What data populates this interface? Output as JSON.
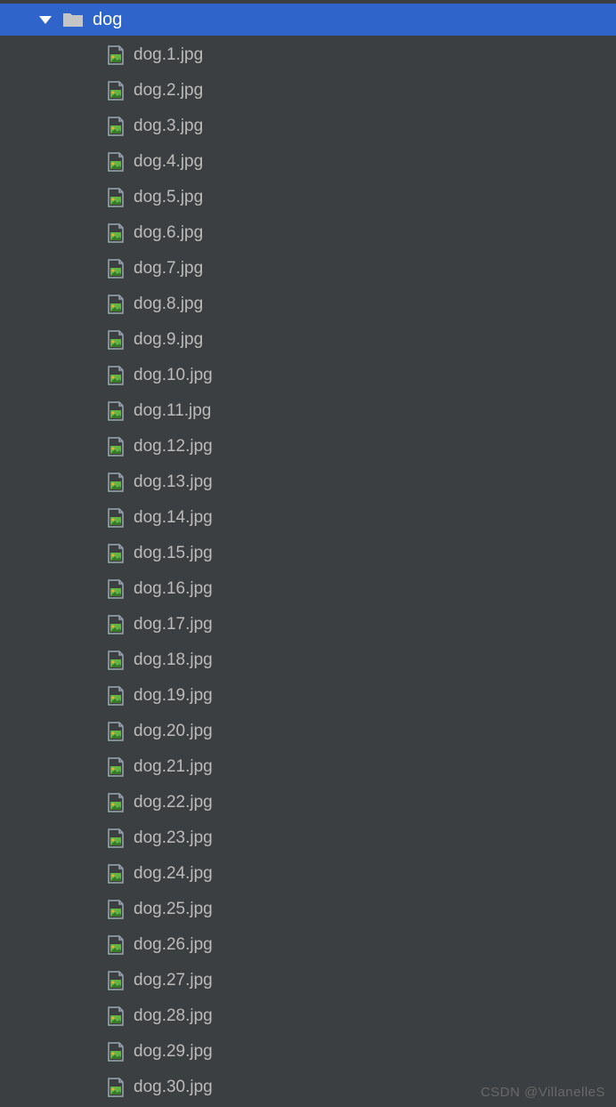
{
  "folder": {
    "name": "dog",
    "expanded": true
  },
  "files": [
    {
      "name": "dog.1.jpg"
    },
    {
      "name": "dog.2.jpg"
    },
    {
      "name": "dog.3.jpg"
    },
    {
      "name": "dog.4.jpg"
    },
    {
      "name": "dog.5.jpg"
    },
    {
      "name": "dog.6.jpg"
    },
    {
      "name": "dog.7.jpg"
    },
    {
      "name": "dog.8.jpg"
    },
    {
      "name": "dog.9.jpg"
    },
    {
      "name": "dog.10.jpg"
    },
    {
      "name": "dog.11.jpg"
    },
    {
      "name": "dog.12.jpg"
    },
    {
      "name": "dog.13.jpg"
    },
    {
      "name": "dog.14.jpg"
    },
    {
      "name": "dog.15.jpg"
    },
    {
      "name": "dog.16.jpg"
    },
    {
      "name": "dog.17.jpg"
    },
    {
      "name": "dog.18.jpg"
    },
    {
      "name": "dog.19.jpg"
    },
    {
      "name": "dog.20.jpg"
    },
    {
      "name": "dog.21.jpg"
    },
    {
      "name": "dog.22.jpg"
    },
    {
      "name": "dog.23.jpg"
    },
    {
      "name": "dog.24.jpg"
    },
    {
      "name": "dog.25.jpg"
    },
    {
      "name": "dog.26.jpg"
    },
    {
      "name": "dog.27.jpg"
    },
    {
      "name": "dog.28.jpg"
    },
    {
      "name": "dog.29.jpg"
    },
    {
      "name": "dog.30.jpg"
    }
  ],
  "watermark": "CSDN @VillanelleS"
}
